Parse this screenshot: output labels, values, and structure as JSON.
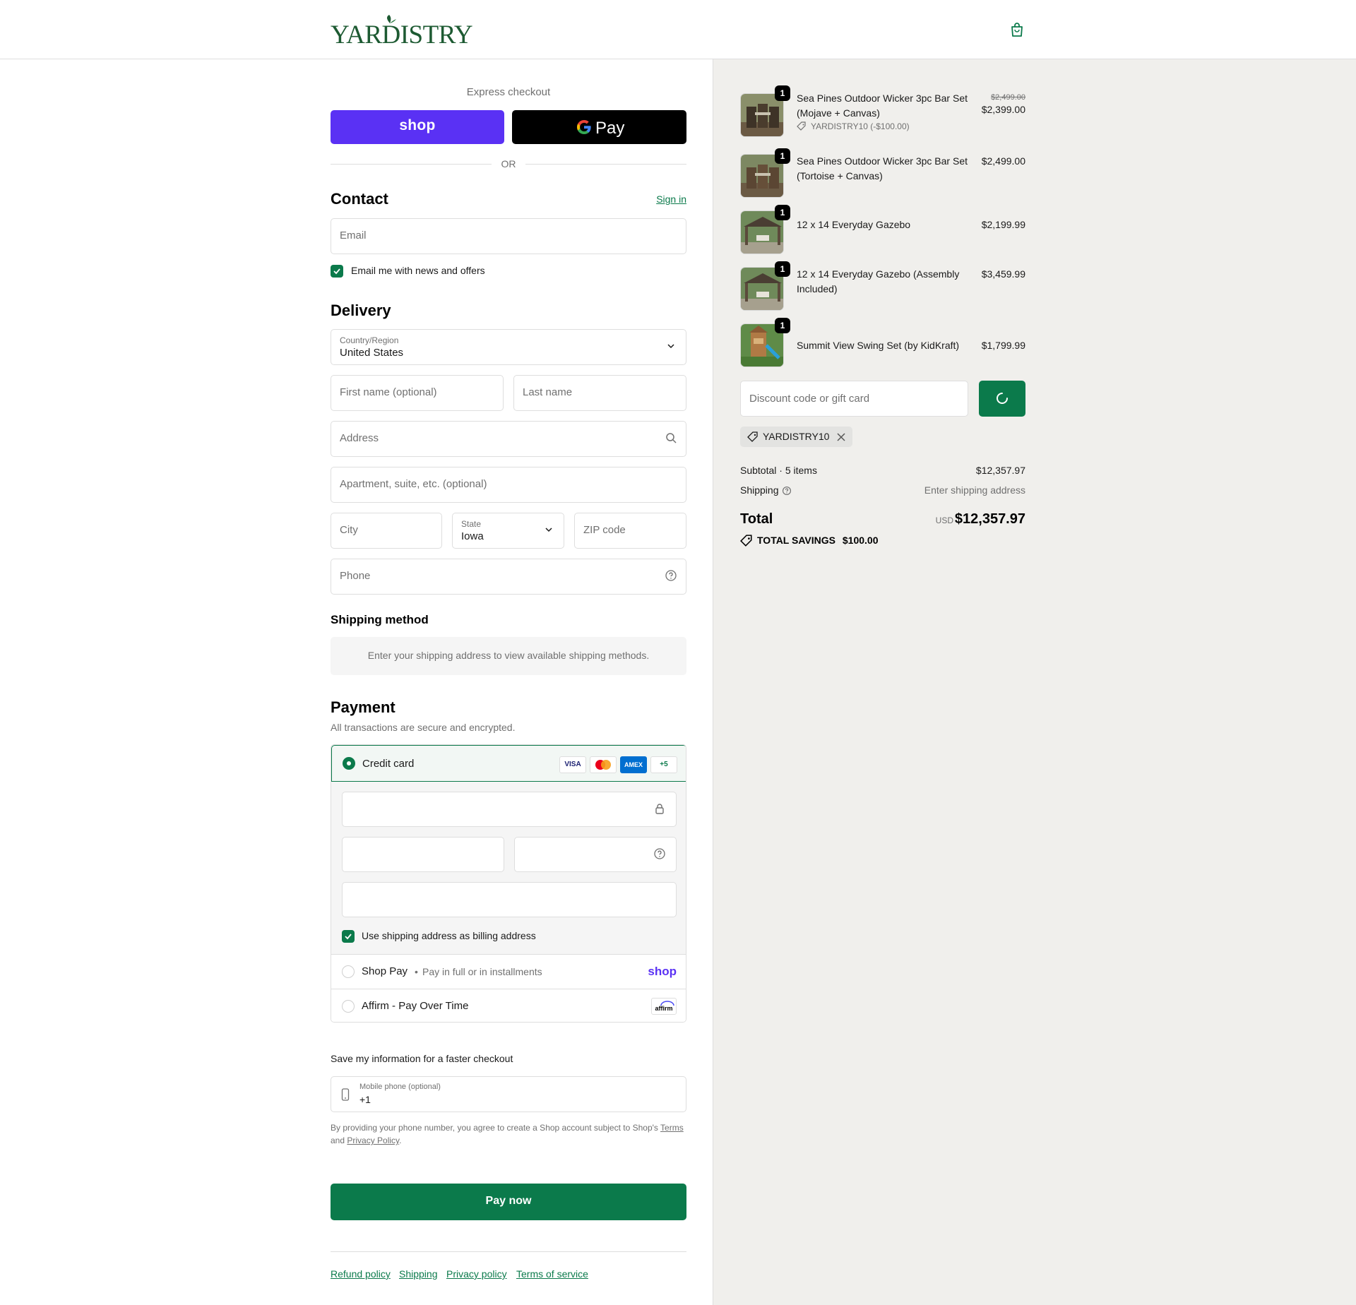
{
  "brand": {
    "name": "YARDISTRY",
    "accent": "#0b7a4b",
    "logo_color": "#1d5a32"
  },
  "header": {
    "cart_icon": "shopping-bag-icon"
  },
  "express": {
    "label": "Express checkout",
    "shop_pay_label": "shop",
    "google_pay_label": "Pay",
    "or_label": "OR"
  },
  "contact": {
    "title": "Contact",
    "sign_in": "Sign in",
    "email_placeholder": "Email",
    "news_opt_in": "Email me with news and offers",
    "news_opt_in_checked": true
  },
  "delivery": {
    "title": "Delivery",
    "country_label": "Country/Region",
    "country_value": "United States",
    "first_name_placeholder": "First name (optional)",
    "last_name_placeholder": "Last name",
    "address_placeholder": "Address",
    "apartment_placeholder": "Apartment, suite, etc. (optional)",
    "city_placeholder": "City",
    "state_label": "State",
    "state_value": "Iowa",
    "zip_placeholder": "ZIP code",
    "phone_placeholder": "Phone"
  },
  "shipping_method": {
    "title": "Shipping method",
    "message": "Enter your shipping address to view available shipping methods."
  },
  "payment": {
    "title": "Payment",
    "subtitle": "All transactions are secure and encrypted.",
    "credit_card_label": "Credit card",
    "card_brands": [
      "VISA",
      "mastercard",
      "AMEX",
      "+5"
    ],
    "billing_same_label": "Use shipping address as billing address",
    "billing_same_checked": true,
    "shop_pay_label": "Shop Pay",
    "shop_pay_note": "Pay in full or in installments",
    "shop_pay_logo": "shop",
    "affirm_label": "Affirm - Pay Over Time",
    "affirm_logo": "affirm"
  },
  "save_info": {
    "title": "Save my information for a faster checkout",
    "mobile_label": "Mobile phone (optional)",
    "mobile_value": "+1",
    "legal_prefix": "By providing your phone number, you agree to create a Shop account subject to Shop's ",
    "legal_terms": "Terms",
    "legal_and": "and ",
    "legal_privacy": "Privacy Policy",
    "legal_suffix": "."
  },
  "pay_now": "Pay now",
  "footer": [
    "Refund policy",
    "Shipping",
    "Privacy policy",
    "Terms of service"
  ],
  "summary": {
    "items": [
      {
        "qty": "1",
        "name": "Sea Pines Outdoor Wicker 3pc Bar Set (Mojave + Canvas)",
        "old_price": "$2,499.00",
        "price": "$2,399.00",
        "discount": "YARDISTRY10 (-$100.00)"
      },
      {
        "qty": "1",
        "name": "Sea Pines Outdoor Wicker 3pc Bar Set (Tortoise + Canvas)",
        "price": "$2,499.00"
      },
      {
        "qty": "1",
        "name": "12 x 14 Everyday Gazebo",
        "price": "$2,199.99"
      },
      {
        "qty": "1",
        "name": "12 x 14 Everyday Gazebo (Assembly Included)",
        "price": "$3,459.99"
      },
      {
        "qty": "1",
        "name": "Summit View Swing Set (by KidKraft)",
        "price": "$1,799.99"
      }
    ],
    "discount_placeholder": "Discount code or gift card",
    "applied_code": "YARDISTRY10",
    "subtotal_label": "Subtotal · 5 items",
    "subtotal_value": "$12,357.97",
    "shipping_label": "Shipping",
    "shipping_value": "Enter shipping address",
    "total_label": "Total",
    "total_currency": "USD",
    "total_value": "$12,357.97",
    "savings_label": "TOTAL SAVINGS",
    "savings_value": "$100.00"
  }
}
